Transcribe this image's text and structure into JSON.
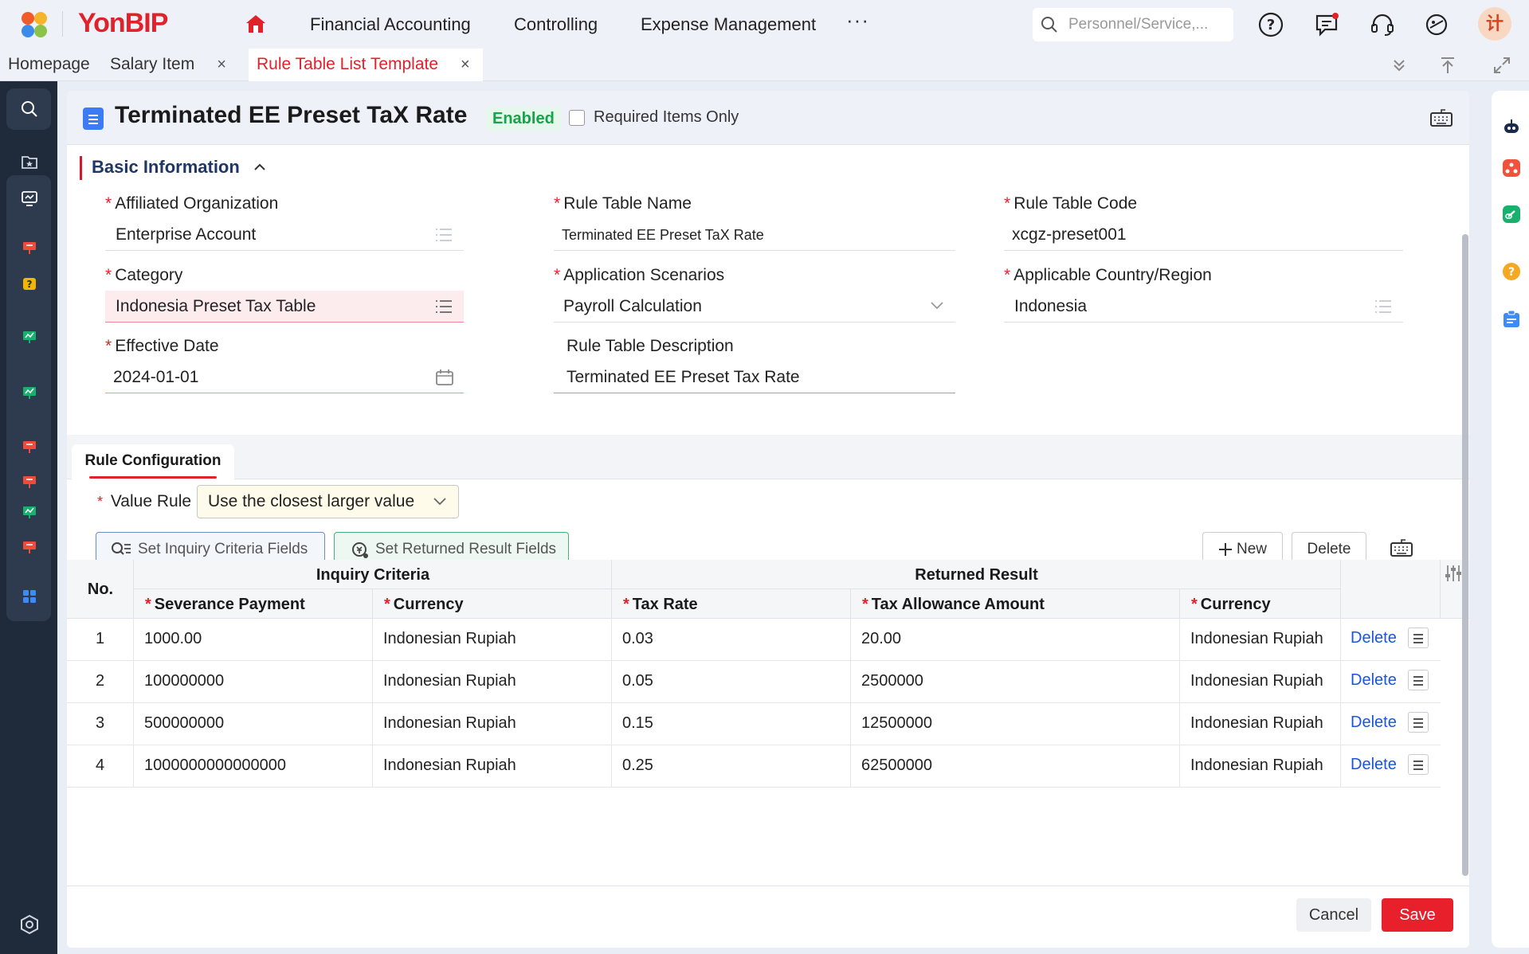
{
  "app": {
    "name": "YonBIP"
  },
  "topnav": {
    "items": [
      "Financial Accounting",
      "Controlling",
      "Expense Management"
    ],
    "more": "···"
  },
  "search": {
    "placeholder": "Personnel/Service,..."
  },
  "user": {
    "avatar_text": "计"
  },
  "tabs": [
    {
      "label": "Homepage"
    },
    {
      "label": "Salary Item",
      "close": "×"
    },
    {
      "label": "Rule Table List Template",
      "close": "×"
    }
  ],
  "page": {
    "title": "Terminated EE Preset TaX Rate",
    "status": "Enabled",
    "required_only_label": "Required Items Only"
  },
  "basic_info": {
    "section_title": "Basic Information",
    "fields": {
      "affiliated_org": {
        "label": "Affiliated Organization",
        "value": "Enterprise Account"
      },
      "rule_table_name": {
        "label": "Rule Table Name",
        "value": "Terminated EE Preset TaX Rate"
      },
      "rule_table_code": {
        "label": "Rule Table Code",
        "value": "xcgz-preset001"
      },
      "category": {
        "label": "Category",
        "value": "Indonesia Preset Tax Table"
      },
      "application_scenarios": {
        "label": "Application Scenarios",
        "value": "Payroll Calculation"
      },
      "country_region": {
        "label": "Applicable Country/Region",
        "value": "Indonesia"
      },
      "effective_date": {
        "label": "Effective Date",
        "value": "2024-01-01"
      },
      "description": {
        "label": "Rule Table Description",
        "value": "Terminated EE Preset Tax Rate"
      }
    }
  },
  "rule_config": {
    "tab_label": "Rule Configuration",
    "value_rule_label": "Value Rule",
    "value_rule_value": "Use the closest larger value",
    "buttons": {
      "inquiry": "Set Inquiry Criteria Fields",
      "returned": "Set Returned Result Fields",
      "new": "New",
      "delete": "Delete"
    },
    "table": {
      "group_headers": {
        "no": "No.",
        "inquiry": "Inquiry Criteria",
        "returned": "Returned Result"
      },
      "columns": [
        "Severance Payment",
        "Currency",
        "Tax Rate",
        "Tax Allowance Amount",
        "Currency"
      ],
      "row_action": "Delete",
      "rows": [
        {
          "no": "1",
          "severance": "1000.00",
          "currency1": "Indonesian Rupiah",
          "tax_rate": "0.03",
          "allowance": "20.00",
          "currency2": "Indonesian Rupiah"
        },
        {
          "no": "2",
          "severance": "100000000",
          "currency1": "Indonesian Rupiah",
          "tax_rate": "0.05",
          "allowance": "2500000",
          "currency2": "Indonesian Rupiah"
        },
        {
          "no": "3",
          "severance": "500000000",
          "currency1": "Indonesian Rupiah",
          "tax_rate": "0.15",
          "allowance": "12500000",
          "currency2": "Indonesian Rupiah"
        },
        {
          "no": "4",
          "severance": "1000000000000000",
          "currency1": "Indonesian Rupiah",
          "tax_rate": "0.25",
          "allowance": "62500000",
          "currency2": "Indonesian Rupiah"
        }
      ]
    }
  },
  "footer": {
    "cancel": "Cancel",
    "save": "Save"
  },
  "colors": {
    "brand_red": "#e0222b",
    "link_blue": "#1a56db",
    "enabled_green": "#18a34a",
    "rail_dark": "#1f2a3b"
  }
}
